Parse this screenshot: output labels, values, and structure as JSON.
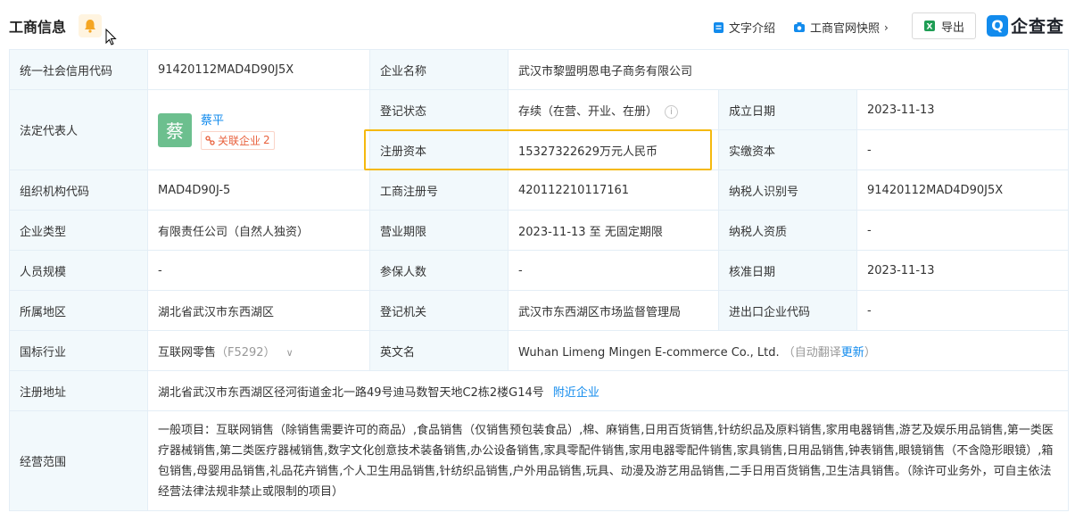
{
  "header": {
    "title": "工商信息",
    "text_intro": "文字介绍",
    "snapshot": "工商官网快照",
    "export": "导出",
    "brand": "企查查",
    "brand_mark": "Q"
  },
  "rows": {
    "credit_code": {
      "label": "统一社会信用代码",
      "value": "91420112MAD4D90J5X"
    },
    "company_name": {
      "label": "企业名称",
      "value": "武汉市黎盟明恩电子商务有限公司"
    },
    "legal_rep": {
      "label": "法定代表人",
      "avatar_char": "蔡",
      "name": "蔡平",
      "related_label": "关联企业",
      "related_count": "2"
    },
    "reg_status": {
      "label": "登记状态",
      "value": "存续（在营、开业、在册）"
    },
    "est_date": {
      "label": "成立日期",
      "value": "2023-11-13"
    },
    "reg_capital": {
      "label": "注册资本",
      "value": "15327322629万元人民币"
    },
    "paid_capital": {
      "label": "实缴资本",
      "value": "-"
    },
    "org_code": {
      "label": "组织机构代码",
      "value": "MAD4D90J-5"
    },
    "biz_reg_no": {
      "label": "工商注册号",
      "value": "420112210117161"
    },
    "taxpayer_id": {
      "label": "纳税人识别号",
      "value": "91420112MAD4D90J5X"
    },
    "company_type": {
      "label": "企业类型",
      "value": "有限责任公司（自然人独资）"
    },
    "biz_term": {
      "label": "营业期限",
      "value": "2023-11-13 至 无固定期限"
    },
    "taxpayer_qual": {
      "label": "纳税人资质",
      "value": "-"
    },
    "staff_size": {
      "label": "人员规模",
      "value": "-"
    },
    "insured": {
      "label": "参保人数",
      "value": "-"
    },
    "approval_date": {
      "label": "核准日期",
      "value": "2023-11-13"
    },
    "region": {
      "label": "所属地区",
      "value": "湖北省武汉市东西湖区"
    },
    "reg_authority": {
      "label": "登记机关",
      "value": "武汉市东西湖区市场监督管理局"
    },
    "ie_code": {
      "label": "进出口企业代码",
      "value": "-"
    },
    "industry": {
      "label": "国标行业",
      "value": "互联网零售",
      "code": "（F5292）"
    },
    "english_name": {
      "label": "英文名",
      "value": "Wuhan Limeng Mingen E-commerce Co., Ltd.",
      "note": "（自动翻译",
      "update": "更新",
      "note_end": "）"
    },
    "reg_address": {
      "label": "注册地址",
      "value": "湖北省武汉市东西湖区径河街道金北一路49号迪马数智天地C2栋2楼G14号",
      "nearby": "附近企业"
    },
    "biz_scope": {
      "label": "经营范围",
      "value": "一般项目：互联网销售（除销售需要许可的商品）,食品销售（仅销售预包装食品）,棉、麻销售,日用百货销售,针纺织品及原料销售,家用电器销售,游艺及娱乐用品销售,第一类医疗器械销售,第二类医疗器械销售,数字文化创意技术装备销售,办公设备销售,家具零配件销售,家用电器零配件销售,家具销售,日用品销售,钟表销售,眼镜销售（不含隐形眼镜）,箱包销售,母婴用品销售,礼品花卉销售,个人卫生用品销售,针纺织品销售,户外用品销售,玩具、动漫及游艺用品销售,二手日用百货销售,卫生洁具销售。（除许可业务外，可自主依法经营法律法规非禁止或限制的项目）"
    }
  },
  "colors": {
    "accent": "#128bed",
    "label_bg": "#f2f9fc",
    "highlight": "#f5b90f",
    "tag": "#e8603c"
  }
}
